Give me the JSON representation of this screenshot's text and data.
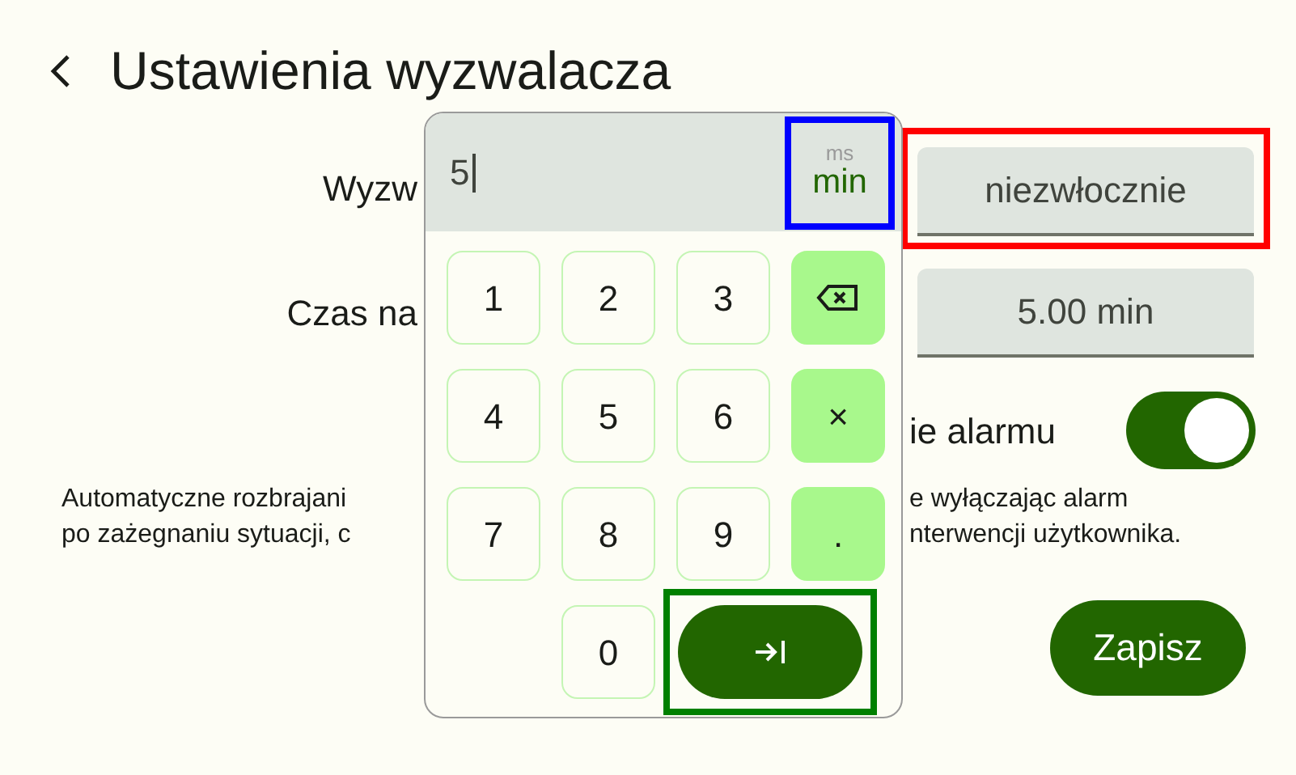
{
  "header": {
    "title": "Ustawienia wyzwalacza"
  },
  "form": {
    "trigger_label": "Wyzw",
    "trigger_value": "niezwłocznie",
    "time_label": "Czas na",
    "time_value": "5.00 min",
    "alarm_label": "ie alarmu",
    "alarm_on": true,
    "description_left": [
      "Automatyczne rozbrajani",
      "po zażegnaniu sytuacji, c"
    ],
    "description_right": [
      "e wyłączając alarm",
      "nterwencji użytkownika."
    ]
  },
  "save_button": "Zapisz",
  "keypad": {
    "value": "5",
    "units": [
      {
        "label": "ms",
        "selected": false
      },
      {
        "label": "min",
        "selected": true
      }
    ],
    "keys": [
      {
        "kind": "digit",
        "label": "1"
      },
      {
        "kind": "digit",
        "label": "2"
      },
      {
        "kind": "digit",
        "label": "3"
      },
      {
        "kind": "backspace"
      },
      {
        "kind": "digit",
        "label": "4"
      },
      {
        "kind": "digit",
        "label": "5"
      },
      {
        "kind": "digit",
        "label": "6"
      },
      {
        "kind": "action",
        "label": "×"
      },
      {
        "kind": "digit",
        "label": "7"
      },
      {
        "kind": "digit",
        "label": "8"
      },
      {
        "kind": "digit",
        "label": "9"
      },
      {
        "kind": "action",
        "label": "."
      },
      {
        "kind": "digit",
        "label": "0"
      },
      {
        "kind": "enter"
      }
    ]
  }
}
